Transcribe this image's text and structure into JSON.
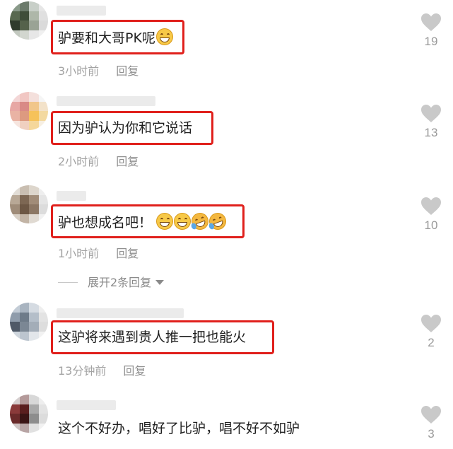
{
  "comments": [
    {
      "text": "驴要和大哥PK呢",
      "time": "3小时前",
      "reply": "回复",
      "likes": "19",
      "emoji_count": 1
    },
    {
      "text": "因为驴认为你和它说话",
      "time": "2小时前",
      "reply": "回复",
      "likes": "13"
    },
    {
      "text": "驴也想成名吧！",
      "time": "1小时前",
      "reply": "回复",
      "likes": "10",
      "emoji_names": [
        "grin-emoji",
        "grin-emoji",
        "rolling-laugh-emoji",
        "rolling-laugh-emoji"
      ]
    },
    {
      "text": "这驴将来遇到贵人推一把也能火",
      "time": "13分钟前",
      "reply": "回复",
      "likes": "2"
    },
    {
      "text": "这个不好办，唱好了比驴，唱不好不如驴",
      "likes": "3"
    }
  ],
  "expand_replies": "展开2条回复",
  "colors": {
    "highlight": "#e0201c",
    "meta": "#a3a3a3",
    "like_icon": "#c9c9c9"
  },
  "icons": {
    "like": "heart-icon",
    "expand": "chevron-down-icon"
  }
}
